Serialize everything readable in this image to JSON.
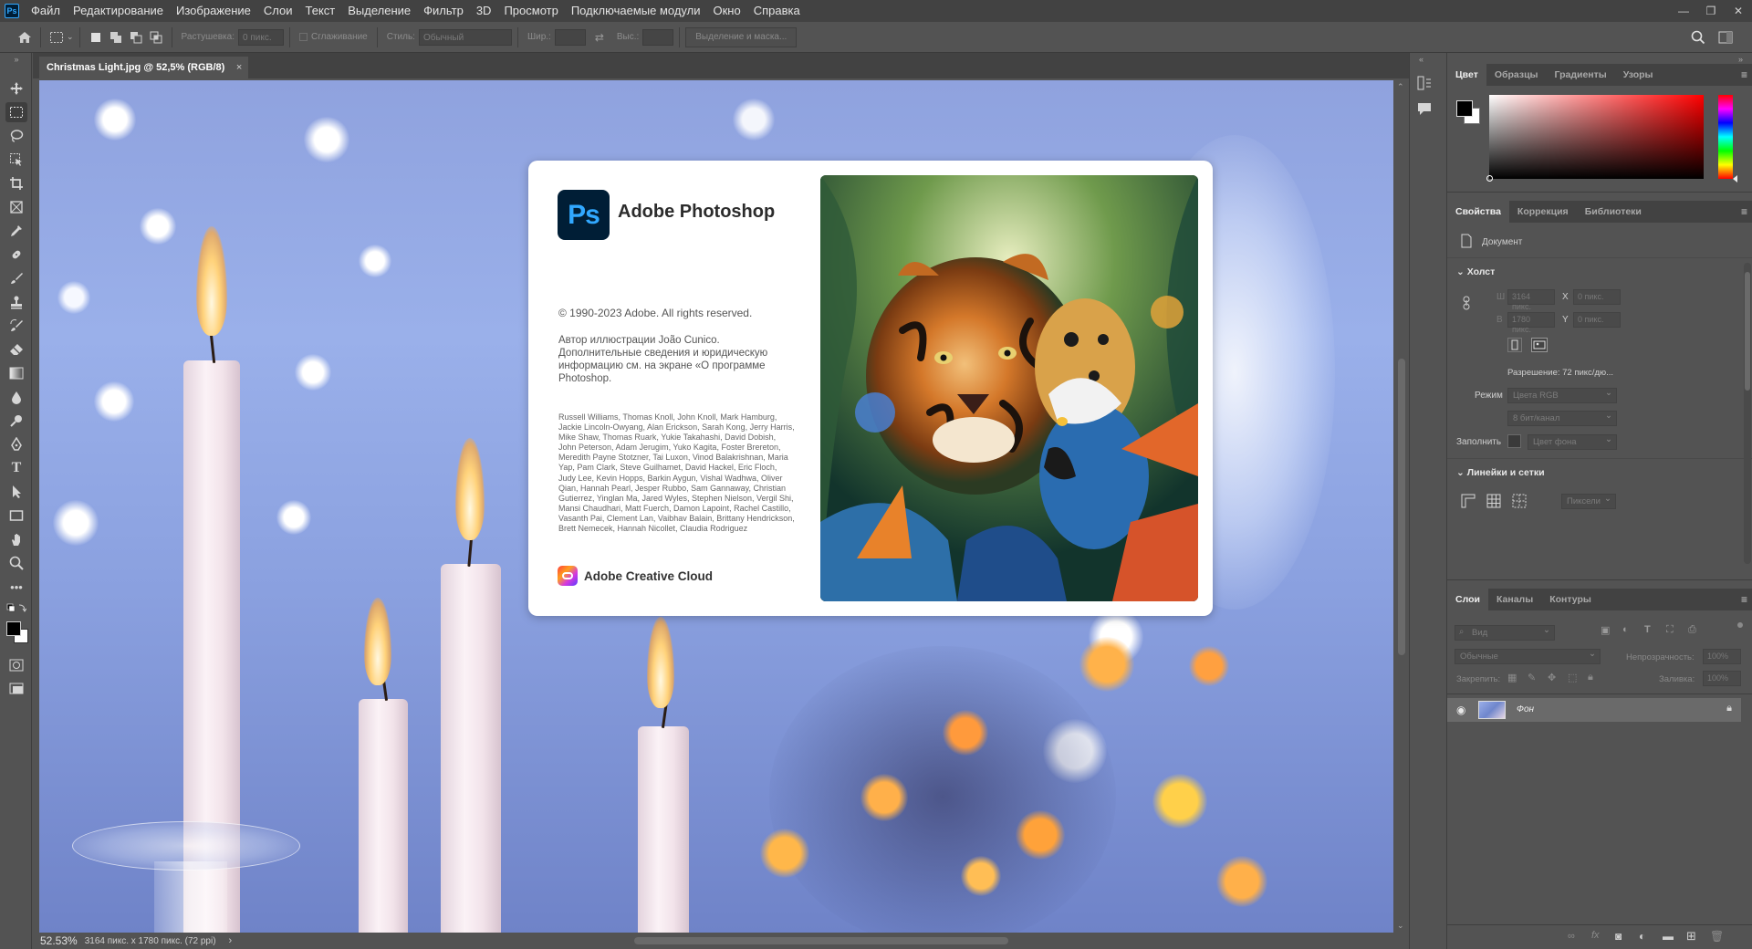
{
  "menubar": {
    "app_logo": "Ps",
    "items": [
      "Файл",
      "Редактирование",
      "Изображение",
      "Слои",
      "Текст",
      "Выделение",
      "Фильтр",
      "3D",
      "Просмотр",
      "Подключаемые модули",
      "Окно",
      "Справка"
    ],
    "window_controls": {
      "minimize": "—",
      "restore": "❐",
      "close": "✕"
    }
  },
  "options": {
    "feather_label": "Растушевка:",
    "feather_value": "0 пикс.",
    "antialias_label": "Сглаживание",
    "style_label": "Стиль:",
    "style_value": "Обычный",
    "width_label": "Шир.:",
    "height_label": "Выс.:",
    "swap_icon": "⇄",
    "select_mask_label": "Выделение и маска..."
  },
  "document": {
    "tab_title": "Christmas Light.jpg @ 52,5% (RGB/8)",
    "tab_close": "×"
  },
  "status": {
    "zoom": "52.53%",
    "dimensions": "3164 пикс. x 1780 пикс. (72 ppi)",
    "arrow": "›"
  },
  "splash": {
    "icon_text": "Ps",
    "title": "Adobe Photoshop",
    "copyright": "© 1990-2023 Adobe. All rights reserved.",
    "author": "Автор иллюстрации João Cunico. Дополнительные сведения и юридическую информацию см. на экране «О программе Photoshop.",
    "credits": "Russell Williams, Thomas Knoll, John Knoll, Mark Hamburg, Jackie Lincoln-Owyang, Alan Erickson, Sarah Kong, Jerry Harris, Mike Shaw, Thomas Ruark, Yukie Takahashi, David Dobish, John Peterson, Adam Jerugim, Yuko Kagita, Foster Brereton, Meredith Payne Stotzner, Tai Luxon, Vinod Balakrishnan, Maria Yap, Pam Clark, Steve Guilhamet, David Hackel, Eric Floch, Judy Lee, Kevin Hopps, Barkin Aygun, Vishal Wadhwa, Oliver Qian, Hannah Pearl, Jesper Rubbo, Sam Gannaway, Christian Gutierrez, Yinglan Ma, Jared Wyles, Stephen Nielson, Vergil Shi, Mansi Chaudhari, Matt Fuerch, Damon Lapoint, Rachel Castillo, Vasanth Pai, Clement Lan, Vaibhav Balain, Brittany Hendrickson, Brett Nemecek, Hannah Nicollet, Claudia Rodriguez",
    "cc_label": "Adobe Creative Cloud"
  },
  "color_panel": {
    "tabs": [
      "Цвет",
      "Образцы",
      "Градиенты",
      "Узоры"
    ],
    "foreground": "#000000",
    "background": "#ffffff",
    "hue_base": "#ff0000"
  },
  "properties_panel": {
    "tabs": [
      "Свойства",
      "Коррекция",
      "Библиотеки"
    ],
    "doc_label": "Документ",
    "canvas_section": "Холст",
    "w_label": "Ш",
    "w_value": "3164 пикс.",
    "h_label": "В",
    "h_value": "1780 пикс.",
    "x_label": "X",
    "x_value": "0 пикс.",
    "y_label": "Y",
    "y_value": "0 пикс.",
    "resolution": "Разрешение: 72 пикс/дю...",
    "mode_label": "Режим",
    "mode_value": "Цвета RGB",
    "depth_value": "8 бит/канал",
    "fill_label": "Заполнить",
    "fill_value": "Цвет фона",
    "rulers_section": "Линейки и сетки",
    "units_value": "Пиксели"
  },
  "layers_panel": {
    "tabs": [
      "Слои",
      "Каналы",
      "Контуры"
    ],
    "search_placeholder": "Вид",
    "blend_mode": "Обычные",
    "opacity_label": "Непрозрачность:",
    "opacity_value": "100%",
    "lock_label": "Закрепить:",
    "fill_label": "Заливка:",
    "fill_value": "100%",
    "layers": [
      {
        "name": "Фон",
        "visible": true,
        "locked": true
      }
    ]
  }
}
